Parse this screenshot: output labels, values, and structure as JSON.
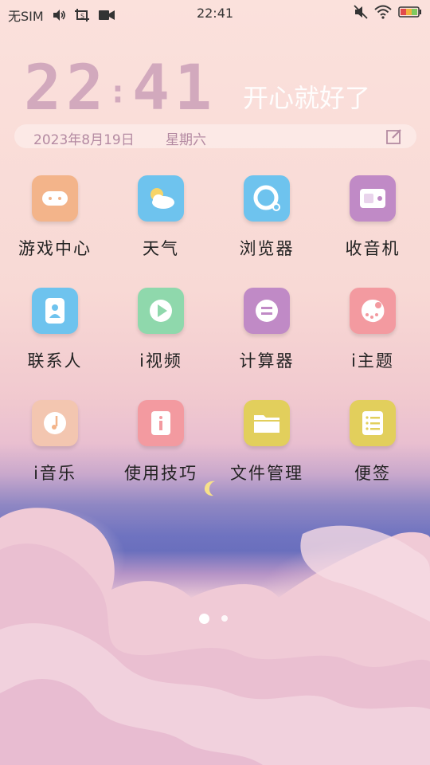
{
  "status_bar": {
    "carrier": "无SIM",
    "time": "22:41",
    "icons": [
      "volume-icon",
      "screenshot-icon",
      "video-record-icon",
      "silent-icon",
      "wifi-icon",
      "battery-icon"
    ]
  },
  "clock_widget": {
    "hours": "22",
    "minutes": "41",
    "slogan": "开心就好了",
    "date": "2023年8月19日",
    "weekday": "星期六"
  },
  "apps": [
    {
      "label": "游戏中心",
      "icon": "gamepad-icon",
      "color": "#f3b48a"
    },
    {
      "label": "天气",
      "icon": "weather-icon",
      "color": "#6ec3ee"
    },
    {
      "label": "浏览器",
      "icon": "browser-icon",
      "color": "#6ec3ee"
    },
    {
      "label": "收音机",
      "icon": "radio-icon",
      "color": "#c08ac6"
    },
    {
      "label": "联系人",
      "icon": "contacts-icon",
      "color": "#6ec3ee"
    },
    {
      "label": "i视频",
      "icon": "video-play-icon",
      "color": "#8fd8ac"
    },
    {
      "label": "计算器",
      "icon": "calculator-icon",
      "color": "#c08ac6"
    },
    {
      "label": "i主题",
      "icon": "theme-icon",
      "color": "#f39aa0"
    },
    {
      "label": "i音乐",
      "icon": "music-icon",
      "color": "#f3c6b0"
    },
    {
      "label": "使用技巧",
      "icon": "tips-icon",
      "color": "#f39aa0"
    },
    {
      "label": "文件管理",
      "icon": "folder-icon",
      "color": "#e2cf5c"
    },
    {
      "label": "便签",
      "icon": "notes-icon",
      "color": "#e2cf5c"
    }
  ],
  "page_indicator": {
    "pages": 2,
    "active": 1
  }
}
